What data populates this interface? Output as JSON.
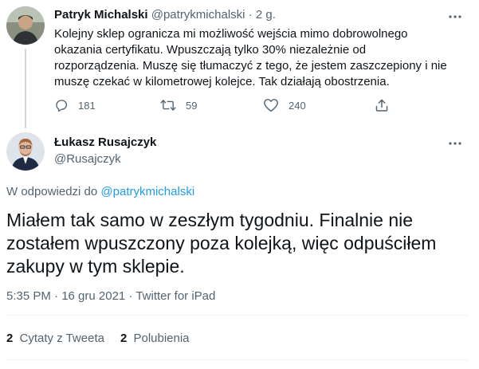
{
  "parent_tweet": {
    "author_name": "Patryk Michalski",
    "handle": "@patrykmichalski",
    "separator": "·",
    "time": "2 g.",
    "text": "Kolejny sklep ogranicza mi możliwość wejścia mimo dobrowolnego okazania certyfikatu. Wpuszczają tylko 30% niezależnie od rozporządzenia. Muszę się tłumaczyć z tego, że jestem zaszczepiony i nie muszę czekać w kilometrowej kolejce. Tak działają obostrzenia.",
    "actions": {
      "reply_count": "181",
      "retweet_count": "59",
      "like_count": "240"
    }
  },
  "reply_tweet": {
    "author_name": "Łukasz Rusajczyk",
    "handle": "@Rusajczyk",
    "reply_prefix": "W odpowiedzi do",
    "reply_to_handle": "@patrykmichalski",
    "text": "Miałem tak samo w zeszłym tygodniu. Finalnie nie zostałem wpuszczony poza kolejką, więc odpuściłem zakupy w tym sklepie.",
    "meta": "5:35 PM · 16 gru 2021 · Twitter for iPad",
    "stats": {
      "quotes_count": "2",
      "quotes_label": "Cytaty z Tweeta",
      "likes_count": "2",
      "likes_label": "Polubienia"
    }
  },
  "icons": {
    "reply": "reply-icon",
    "retweet": "retweet-icon",
    "like": "heart-icon",
    "share": "share-icon",
    "more": "more-icon"
  },
  "colors": {
    "text_primary": "#0f1419",
    "text_secondary": "#536471",
    "link": "#1d9bf0",
    "divider": "#eff3f4",
    "thread_line": "#cfd9de"
  }
}
